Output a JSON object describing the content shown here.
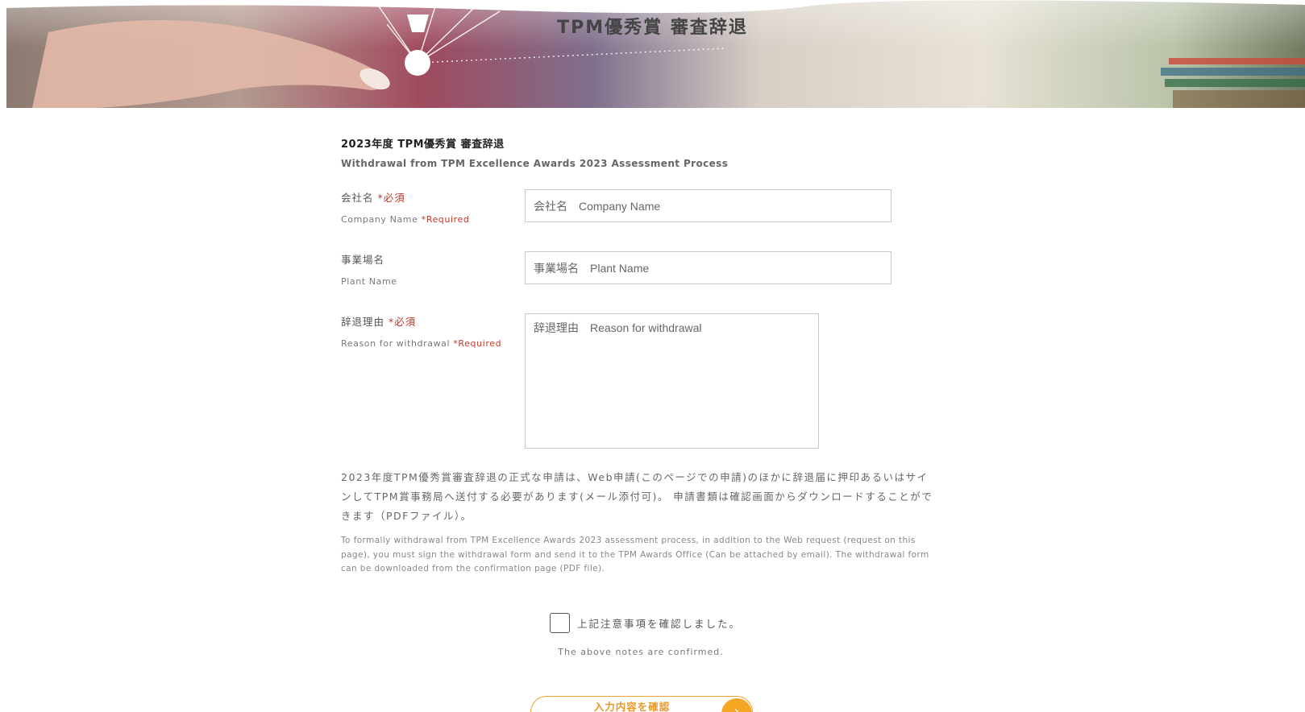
{
  "hero": {
    "title": "TPM優秀賞 審査辞退"
  },
  "heading": {
    "ja": "2023年度 TPM優秀賞 審査辞退",
    "en": "Withdrawal from TPM Excellence Awards 2023 Assessment Process"
  },
  "fields": {
    "company": {
      "label_ja": "会社名",
      "required_ja": "*必須",
      "label_en": "Company Name",
      "required_en": "*Required",
      "placeholder": "会社名　Company Name"
    },
    "plant": {
      "label_ja": "事業場名",
      "label_en": "Plant Name",
      "placeholder": "事業場名　Plant Name"
    },
    "reason": {
      "label_ja": "辞退理由",
      "required_ja": "*必須",
      "label_en": "Reason for withdrawal",
      "required_en": "*Required",
      "placeholder": "辞退理由　Reason for withdrawal"
    }
  },
  "notice": {
    "ja": "2023年度TPM優秀賞審査辞退の正式な申請は、Web申請(このページでの申請)のほかに辞退届に押印あるいはサインしてTPM賞事務局へ送付する必要があります(メール添付可)。 申請書類は確認画面からダウンロードすることができます（PDFファイル）。",
    "en": "To formally withdrawal from TPM Excellence Awards 2023 assessment process, in addition to the Web request (request on this page), you must sign the withdrawal form and send it to the TPM Awards Office (Can be attached by email). The withdrawal form can be downloaded from the confirmation page (PDF file)."
  },
  "confirm": {
    "ja": "上記注意事項を確認しました。",
    "en": "The above notes are confirmed.",
    "checked": false
  },
  "submit": {
    "label": "入力内容を確認",
    "arrow_icon": "chevron-right-icon"
  },
  "colors": {
    "required": "#c0392b",
    "accent": "#f5a623"
  }
}
